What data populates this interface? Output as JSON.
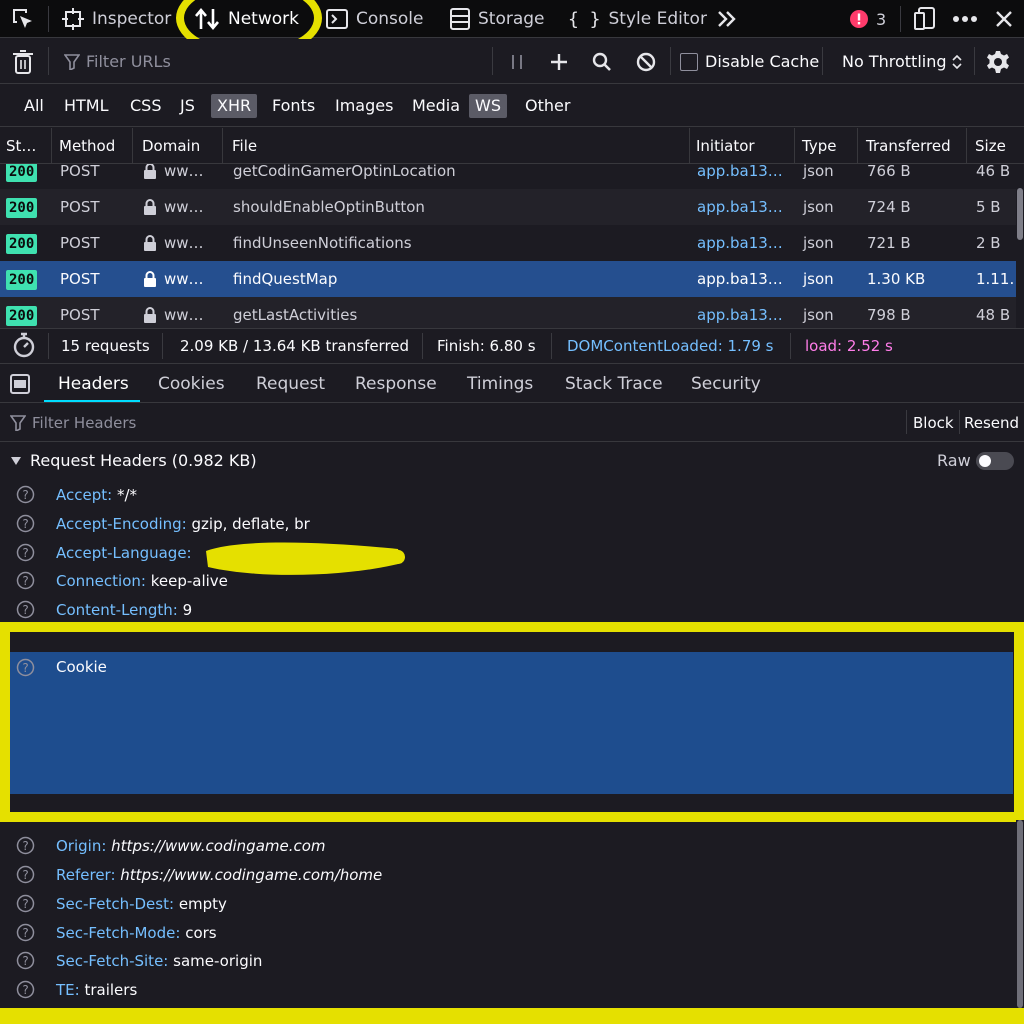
{
  "toolbar": {
    "inspector": "Inspector",
    "network": "Network",
    "console": "Console",
    "storage": "Storage",
    "style_editor": "Style Editor",
    "error_count": "3"
  },
  "filterbar": {
    "filter_placeholder": "Filter URLs",
    "disable_cache": "Disable Cache",
    "throttling": "No Throttling"
  },
  "types": [
    "All",
    "HTML",
    "CSS",
    "JS",
    "XHR",
    "Fonts",
    "Images",
    "Media",
    "WS",
    "Other"
  ],
  "columns": [
    "St…",
    "Method",
    "Domain",
    "File",
    "Initiator",
    "Type",
    "Transferred",
    "Size"
  ],
  "rows": [
    {
      "status": "200",
      "method": "POST",
      "domain": "ww…",
      "file": "getCodinGamerOptinLocation",
      "initiator": "app.ba13…",
      "type": "json",
      "transferred": "766 B",
      "size": "46 B"
    },
    {
      "status": "200",
      "method": "POST",
      "domain": "ww…",
      "file": "shouldEnableOptinButton",
      "initiator": "app.ba13…",
      "type": "json",
      "transferred": "724 B",
      "size": "5 B"
    },
    {
      "status": "200",
      "method": "POST",
      "domain": "ww…",
      "file": "findUnseenNotifications",
      "initiator": "app.ba13…",
      "type": "json",
      "transferred": "721 B",
      "size": "2 B"
    },
    {
      "status": "200",
      "method": "POST",
      "domain": "ww…",
      "file": "findQuestMap",
      "initiator": "app.ba13…",
      "type": "json",
      "transferred": "1.30 KB",
      "size": "1.11…"
    },
    {
      "status": "200",
      "method": "POST",
      "domain": "ww…",
      "file": "getLastActivities",
      "initiator": "app.ba13…",
      "type": "json",
      "transferred": "798 B",
      "size": "48 B"
    }
  ],
  "summary": {
    "requests": "15 requests",
    "transferred": "2.09 KB / 13.64 KB transferred",
    "finish": "Finish: 6.80 s",
    "dom": "DOMContentLoaded: 1.79 s",
    "load": "load: 2.52 s"
  },
  "detail_tabs": [
    "Headers",
    "Cookies",
    "Request",
    "Response",
    "Timings",
    "Stack Trace",
    "Security"
  ],
  "header_filter": {
    "placeholder": "Filter Headers",
    "block": "Block",
    "resend": "Resend"
  },
  "request_headers": {
    "title": "Request Headers (0.982 KB)",
    "raw": "Raw",
    "items": [
      {
        "name": "Accept:",
        "value": "*/*"
      },
      {
        "name": "Accept-Encoding:",
        "value": "gzip, deflate, br"
      },
      {
        "name": "Accept-Language:",
        "value": ""
      },
      {
        "name": "Connection:",
        "value": "keep-alive"
      },
      {
        "name": "Content-Length:",
        "value": "9"
      },
      {
        "name": "Cookie",
        "value": ""
      }
    ],
    "items_lower": [
      {
        "name": "Origin:",
        "value": "https://www.codingame.com"
      },
      {
        "name": "Referer:",
        "value": "https://www.codingame.com/home"
      },
      {
        "name": "Sec-Fetch-Dest:",
        "value": "empty"
      },
      {
        "name": "Sec-Fetch-Mode:",
        "value": "cors"
      },
      {
        "name": "Sec-Fetch-Site:",
        "value": "same-origin"
      },
      {
        "name": "TE:",
        "value": "trailers"
      }
    ]
  },
  "colors": {
    "background": "#1c1b22",
    "toolbar_bg": "#0c0c0d",
    "selected_row": "#254f8f",
    "status_ok": "#3fe1b0",
    "link": "#75bfff",
    "dom_loaded": "#75bfff",
    "load": "#ff7de9",
    "annotation": "#e5e000",
    "error": "#ff3b6b"
  }
}
